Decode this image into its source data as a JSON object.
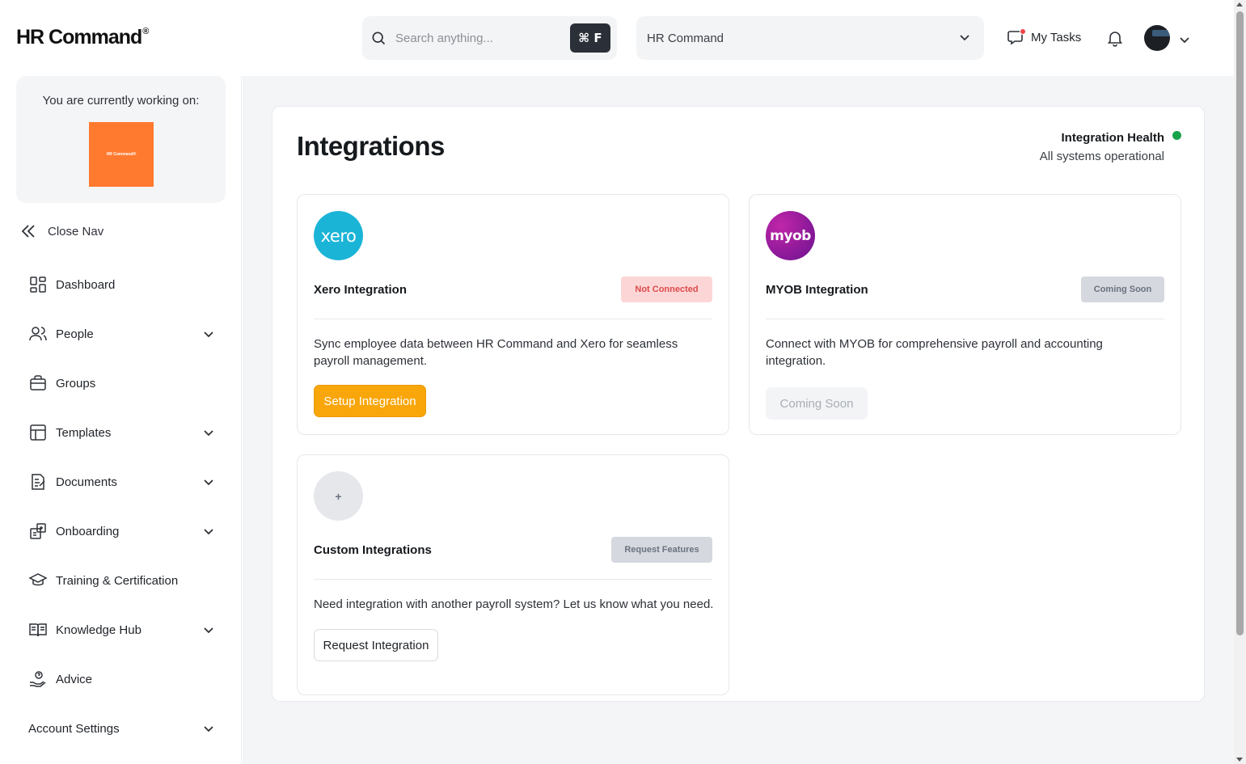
{
  "app": {
    "logo_text": "HR Command",
    "logo_mark": "®"
  },
  "header": {
    "search": {
      "placeholder": "Search anything...",
      "value": "",
      "shortcut": "⌘ F",
      "icon": "search-icon"
    },
    "org_select": {
      "selected": "HR Command",
      "icon": "chevron-down-icon"
    },
    "my_tasks": {
      "label": "My Tasks",
      "icon": "chat-tasks-icon",
      "has_notification_dot": true
    },
    "notifications_icon": "bell-icon",
    "avatar_icon": "avatar"
  },
  "sidebar": {
    "workspace_label": "You are currently working on:",
    "workspace_logo_text": "HR Command®",
    "close_nav_label": "Close Nav",
    "items": [
      {
        "label": "Dashboard",
        "icon": "dashboard-icon",
        "expandable": false
      },
      {
        "label": "People",
        "icon": "people-icon",
        "expandable": true
      },
      {
        "label": "Groups",
        "icon": "briefcase-icon",
        "expandable": false
      },
      {
        "label": "Templates",
        "icon": "template-icon",
        "expandable": true
      },
      {
        "label": "Documents",
        "icon": "document-icon",
        "expandable": true
      },
      {
        "label": "Onboarding",
        "icon": "onboarding-icon",
        "expandable": true
      },
      {
        "label": "Training & Certification",
        "icon": "graduation-cap-icon",
        "expandable": false
      },
      {
        "label": "Knowledge Hub",
        "icon": "book-icon",
        "expandable": true
      },
      {
        "label": "Advice",
        "icon": "advice-icon",
        "expandable": false
      },
      {
        "label": "Account Settings",
        "icon": "",
        "expandable": true
      }
    ]
  },
  "main": {
    "title": "Integrations",
    "health": {
      "title": "Integration Health",
      "status": "All systems operational",
      "color": "#16a34a"
    },
    "cards": {
      "xero": {
        "logo_text": "xero",
        "title": "Xero Integration",
        "badge": "Not Connected",
        "description": "Sync employee data between HR Command and Xero for seamless payroll management.",
        "button": "Setup Integration",
        "logo_color": "#1ab4d7",
        "button_color": "#f9a60b"
      },
      "myob": {
        "logo_text": "myob",
        "title": "MYOB Integration",
        "badge": "Coming Soon",
        "description": "Connect with MYOB for comprehensive payroll and accounting integration.",
        "button": "Coming Soon",
        "logo_color": "#9b1c9b"
      },
      "custom": {
        "logo_text": "+",
        "title": "Custom Integrations",
        "badge": "Request Features",
        "description": "Need integration with another payroll system? Let us know what you need.",
        "button": "Request Integration"
      }
    }
  }
}
